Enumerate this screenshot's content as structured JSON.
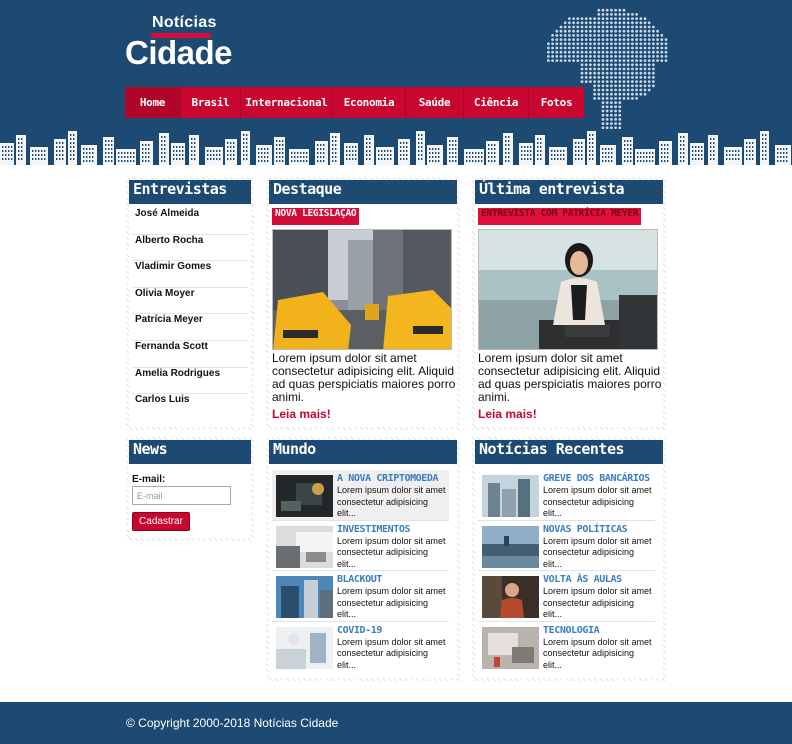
{
  "logo": {
    "top": "Notícias",
    "bottom": "Cidade"
  },
  "nav": [
    "Home",
    "Brasil",
    "Internacional",
    "Economia",
    "Saúde",
    "Ciência",
    "Fotos"
  ],
  "entrevistas": {
    "title": "Entrevistas",
    "items": [
      "José Almeida",
      "Alberto Rocha",
      "Vladimir Gomes",
      "Olivia Moyer",
      "Patrícia Meyer",
      "Fernanda Scott",
      "Amelia Rodrigues",
      "Carlos Luis"
    ]
  },
  "news": {
    "title": "News",
    "email_label": "E-mail:",
    "email_placeholder": "E-mail",
    "button": "Cadastrar"
  },
  "destaque": {
    "title": "Destaque",
    "tag": "NOVA LEGISLAÇÃO",
    "text": "Lorem ipsum dolor sit amet consectetur adipisicing elit. Aliquid ad quas perspiciatis maiores porro animi.",
    "link": "Leia mais!"
  },
  "ultima": {
    "title": "Última entrevista",
    "tag": "ENTREVISTA COM PATRÍCIA MEYER",
    "text": "Lorem ipsum dolor sit amet consectetur adipisicing elit. Aliquid ad quas perspiciatis maiores porro animi.",
    "link": "Leia mais!"
  },
  "mundo": {
    "title": "Mundo",
    "items": [
      {
        "title": "A NOVA CRIPTOMOEDA",
        "text": "Lorem ipsum dolor sit amet consectetur adipisicing elit..."
      },
      {
        "title": "INVESTIMENTOS",
        "text": "Lorem ipsum dolor sit amet consectetur adipisicing elit..."
      },
      {
        "title": "BLACKOUT",
        "text": "Lorem ipsum dolor sit amet consectetur adipisicing elit..."
      },
      {
        "title": "COVID-19",
        "text": "Lorem ipsum dolor sit amet consectetur adipisicing elit..."
      }
    ]
  },
  "recentes": {
    "title": "Notícias Recentes",
    "items": [
      {
        "title": "GREVE DOS BANCÁRIOS",
        "text": "Lorem ipsum dolor sit amet consectetur adipisicing elit..."
      },
      {
        "title": "NOVAS POLÍTICAS",
        "text": "Lorem ipsum dolor sit amet consectetur adipisicing elit..."
      },
      {
        "title": "VOLTA ÀS AULAS",
        "text": "Lorem ipsum dolor sit amet consectetur adipisicing elit..."
      },
      {
        "title": "TECNOLOGIA",
        "text": "Lorem ipsum dolor sit amet consectetur adipisicing elit..."
      }
    ]
  },
  "footer": {
    "copyright": "© Copyright 2000-2018 Notícias Cidade"
  },
  "colors": {
    "navy": "#1d4a72",
    "red": "#c9062f",
    "link_blue": "#3a7ec0"
  }
}
